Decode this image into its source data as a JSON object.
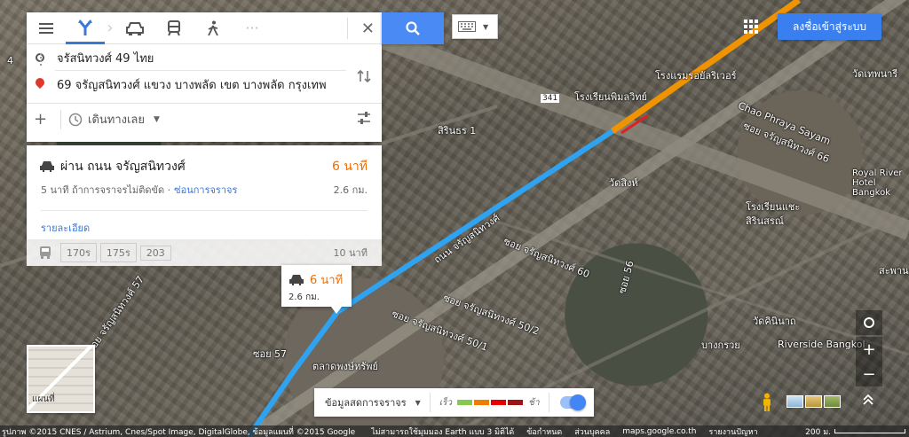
{
  "map": {
    "labels": {
      "road_main": "ถนน จรัญสนิทวงศ์",
      "hotel_royal_river": "โรงแรมรอยัลริเวอร์",
      "school_pimolwit": "โรงเรียนพิมลวิทย์",
      "chao_phraya_sayam": "Chao Phraya Sayam",
      "soi_66": "ซอย จรัญสนิทวงศ์ 66",
      "royal_river_hotel_en": "Royal River Hotel Bangkok",
      "sirinthorn_1": "สิรินธร 1",
      "wat_sing": "วัดสิงห์",
      "school_chae": "โรงเรียนแชะ",
      "sirinsorn": "สิรินสรณ์",
      "soi_60": "ซอย จรัญสนิทวงศ์ 60",
      "soi_50_2": "ซอย จรัญสนิทวงศ์ 50/2",
      "soi_50_1": "ซอย จรัญสนิทวงศ์ 50/1",
      "wat_khemaphirataram": "วัดเทพนารี",
      "riverside": "Riverside Bangkol",
      "wat_kininan": "วัดคินินาถ",
      "bang_kruai": "บางกรวย",
      "soi_57": "ซอย 57",
      "charan_57": "ซอย จรัญสนิทวงศ์ 57",
      "market": "ตลาดพงษ์ทรัพย์",
      "soi_56": "ซอย 56",
      "route_341": "341",
      "sakhon": "สะพาน",
      "soi_4": "4"
    }
  },
  "modes": {
    "best": "best-route",
    "close_label": "✕",
    "more_label": "···"
  },
  "directions": {
    "origin": "จรัสนิทวงศ์ 49 ไทย",
    "destination": "69 จรัญสนิทวงศ์ แขวง บางพลัด เขต บางพลัด กรุงเทพ",
    "add_label": "+",
    "leave_label": "เดินทางเลย"
  },
  "result": {
    "via": "ผ่าน ถนน จรัญสนิทวงศ์",
    "time": "6 นาที",
    "traffic_note": "5 นาที ถ้าการจราจรไม่ติดขัด ·",
    "traffic_link": "ซ่อนการจราจร",
    "distance": "2.6 กม.",
    "details": "รายละเอียด"
  },
  "transit": {
    "lines": [
      "170ร",
      "175ร",
      "203"
    ],
    "time": "10 นาที"
  },
  "topbar": {
    "signin": "ลงชื่อเข้าสู่ระบบ"
  },
  "bubble": {
    "time": "6 นาที",
    "distance": "2.6 กม."
  },
  "minimap": {
    "label": "แผนที่"
  },
  "traffic": {
    "label": "ข้อมูลสดการจราจร",
    "fast": "เร็ว",
    "slow": "ช้า",
    "colors": [
      "#84ca50",
      "#f07d02",
      "#e60000",
      "#9e1313"
    ],
    "enabled": true
  },
  "footer": {
    "credits": "รูปภาพ ©2015 CNES / Astrium, Cnes/Spot Image, DigitalGlobe, ข้อมูลแผนที่ ©2015 Google",
    "earth": "ไม่สามารถใช้มุมมอง Earth แบบ 3 มิติได้",
    "terms": "ข้อกำหนด",
    "privacy": "ส่วนบุคคล",
    "domain": "maps.google.co.th",
    "report": "รายงานปัญหา",
    "scale": "200 ม."
  },
  "colors": {
    "route": "#2fa2f0",
    "route_orange": "#f09300",
    "accent": "#4a8af4"
  }
}
